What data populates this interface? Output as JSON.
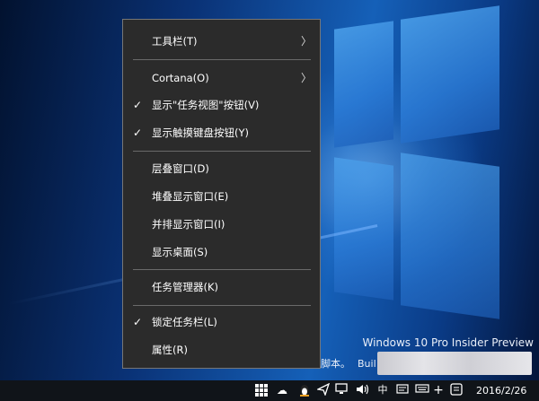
{
  "desktop": {
    "watermark_title": "Windows 10 Pro Insider Preview",
    "watermark_line2_a": "脚本。",
    "watermark_line2_b": "Buil"
  },
  "context_menu": {
    "items": [
      {
        "label": "工具栏(T)",
        "checked": false,
        "submenu": true
      },
      {
        "label": "Cortana(O)",
        "checked": false,
        "submenu": true
      },
      {
        "label": "显示\"任务视图\"按钮(V)",
        "checked": true,
        "submenu": false
      },
      {
        "label": "显示触摸键盘按钮(Y)",
        "checked": true,
        "submenu": false
      },
      {
        "label": "层叠窗口(D)",
        "checked": false,
        "submenu": false
      },
      {
        "label": "堆叠显示窗口(E)",
        "checked": false,
        "submenu": false
      },
      {
        "label": "并排显示窗口(I)",
        "checked": false,
        "submenu": false
      },
      {
        "label": "显示桌面(S)",
        "checked": false,
        "submenu": false
      },
      {
        "label": "任务管理器(K)",
        "checked": false,
        "submenu": false
      },
      {
        "label": "锁定任务栏(L)",
        "checked": true,
        "submenu": false
      },
      {
        "label": "属性(R)",
        "checked": false,
        "submenu": false
      }
    ],
    "check_glyph": "✓",
    "arrow_glyph": "〉"
  },
  "taskbar": {
    "date": "2016/2/26",
    "ime_label": "中",
    "icons": [
      "task-view-grid-icon",
      "onedrive-cloud-icon",
      "qq-penguin-icon",
      "send-icon",
      "network-icon",
      "volume-icon",
      "input-method-icon",
      "action-center-icon",
      "touch-keyboard-icon",
      "plus-icon",
      "notification-icon"
    ]
  },
  "colors": {
    "menu_background": "#2b2b2b",
    "menu_border": "#767676",
    "taskbar_background": "#101419",
    "text": "#ffffff"
  }
}
